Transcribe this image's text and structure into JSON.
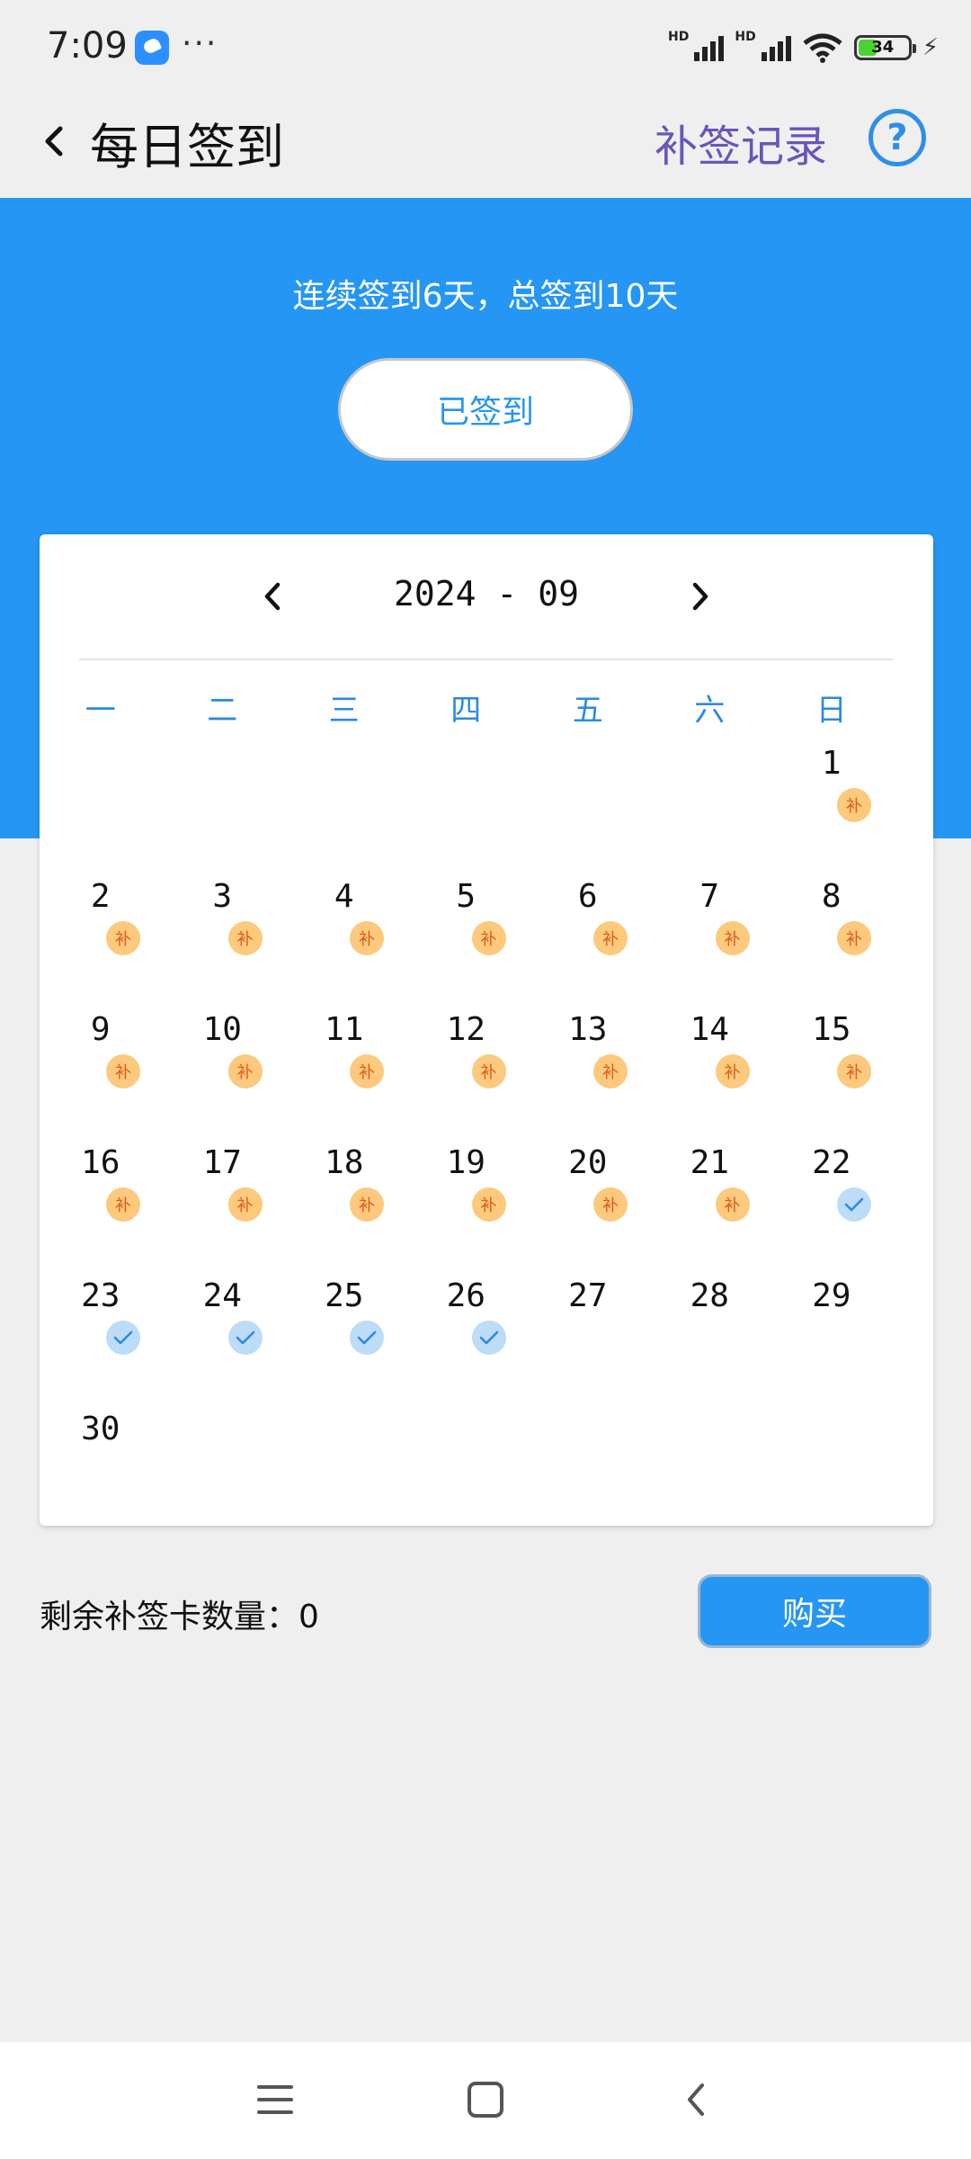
{
  "status": {
    "time": "7:09",
    "dots": "···",
    "hd1": "HD",
    "hd2": "HD",
    "battery": "34"
  },
  "header": {
    "title": "每日签到",
    "makeup_record": "补签记录",
    "help": "?"
  },
  "banner": {
    "summary": "连续签到6天，总签到10天",
    "signed_button": "已签到"
  },
  "calendar": {
    "month": "2024 - 09",
    "weekdays": [
      "一",
      "二",
      "三",
      "四",
      "五",
      "六",
      "日"
    ],
    "badge_text": "补",
    "days": [
      {
        "d": "1",
        "s": "bu"
      },
      {
        "d": "2",
        "s": "bu"
      },
      {
        "d": "3",
        "s": "bu"
      },
      {
        "d": "4",
        "s": "bu"
      },
      {
        "d": "5",
        "s": "bu"
      },
      {
        "d": "6",
        "s": "bu"
      },
      {
        "d": "7",
        "s": "bu"
      },
      {
        "d": "8",
        "s": "bu"
      },
      {
        "d": "9",
        "s": "bu"
      },
      {
        "d": "10",
        "s": "bu"
      },
      {
        "d": "11",
        "s": "bu"
      },
      {
        "d": "12",
        "s": "bu"
      },
      {
        "d": "13",
        "s": "bu"
      },
      {
        "d": "14",
        "s": "bu"
      },
      {
        "d": "15",
        "s": "bu"
      },
      {
        "d": "16",
        "s": "bu"
      },
      {
        "d": "17",
        "s": "bu"
      },
      {
        "d": "18",
        "s": "bu"
      },
      {
        "d": "19",
        "s": "bu"
      },
      {
        "d": "20",
        "s": "bu"
      },
      {
        "d": "21",
        "s": "bu"
      },
      {
        "d": "22",
        "s": "ok"
      },
      {
        "d": "23",
        "s": "ok"
      },
      {
        "d": "24",
        "s": "ok"
      },
      {
        "d": "25",
        "s": "ok"
      },
      {
        "d": "26",
        "s": "ok"
      },
      {
        "d": "27",
        "s": ""
      },
      {
        "d": "28",
        "s": ""
      },
      {
        "d": "29",
        "s": ""
      },
      {
        "d": "30",
        "s": ""
      }
    ],
    "first_weekday_index": 6
  },
  "footer": {
    "cards_left": "剩余补签卡数量：0",
    "buy_button": "购买"
  },
  "colors": {
    "accent": "#2596f3",
    "makeup_badge": "#fcc97d",
    "signed_badge": "#bcdcf8",
    "record_link": "#6a55b8"
  }
}
